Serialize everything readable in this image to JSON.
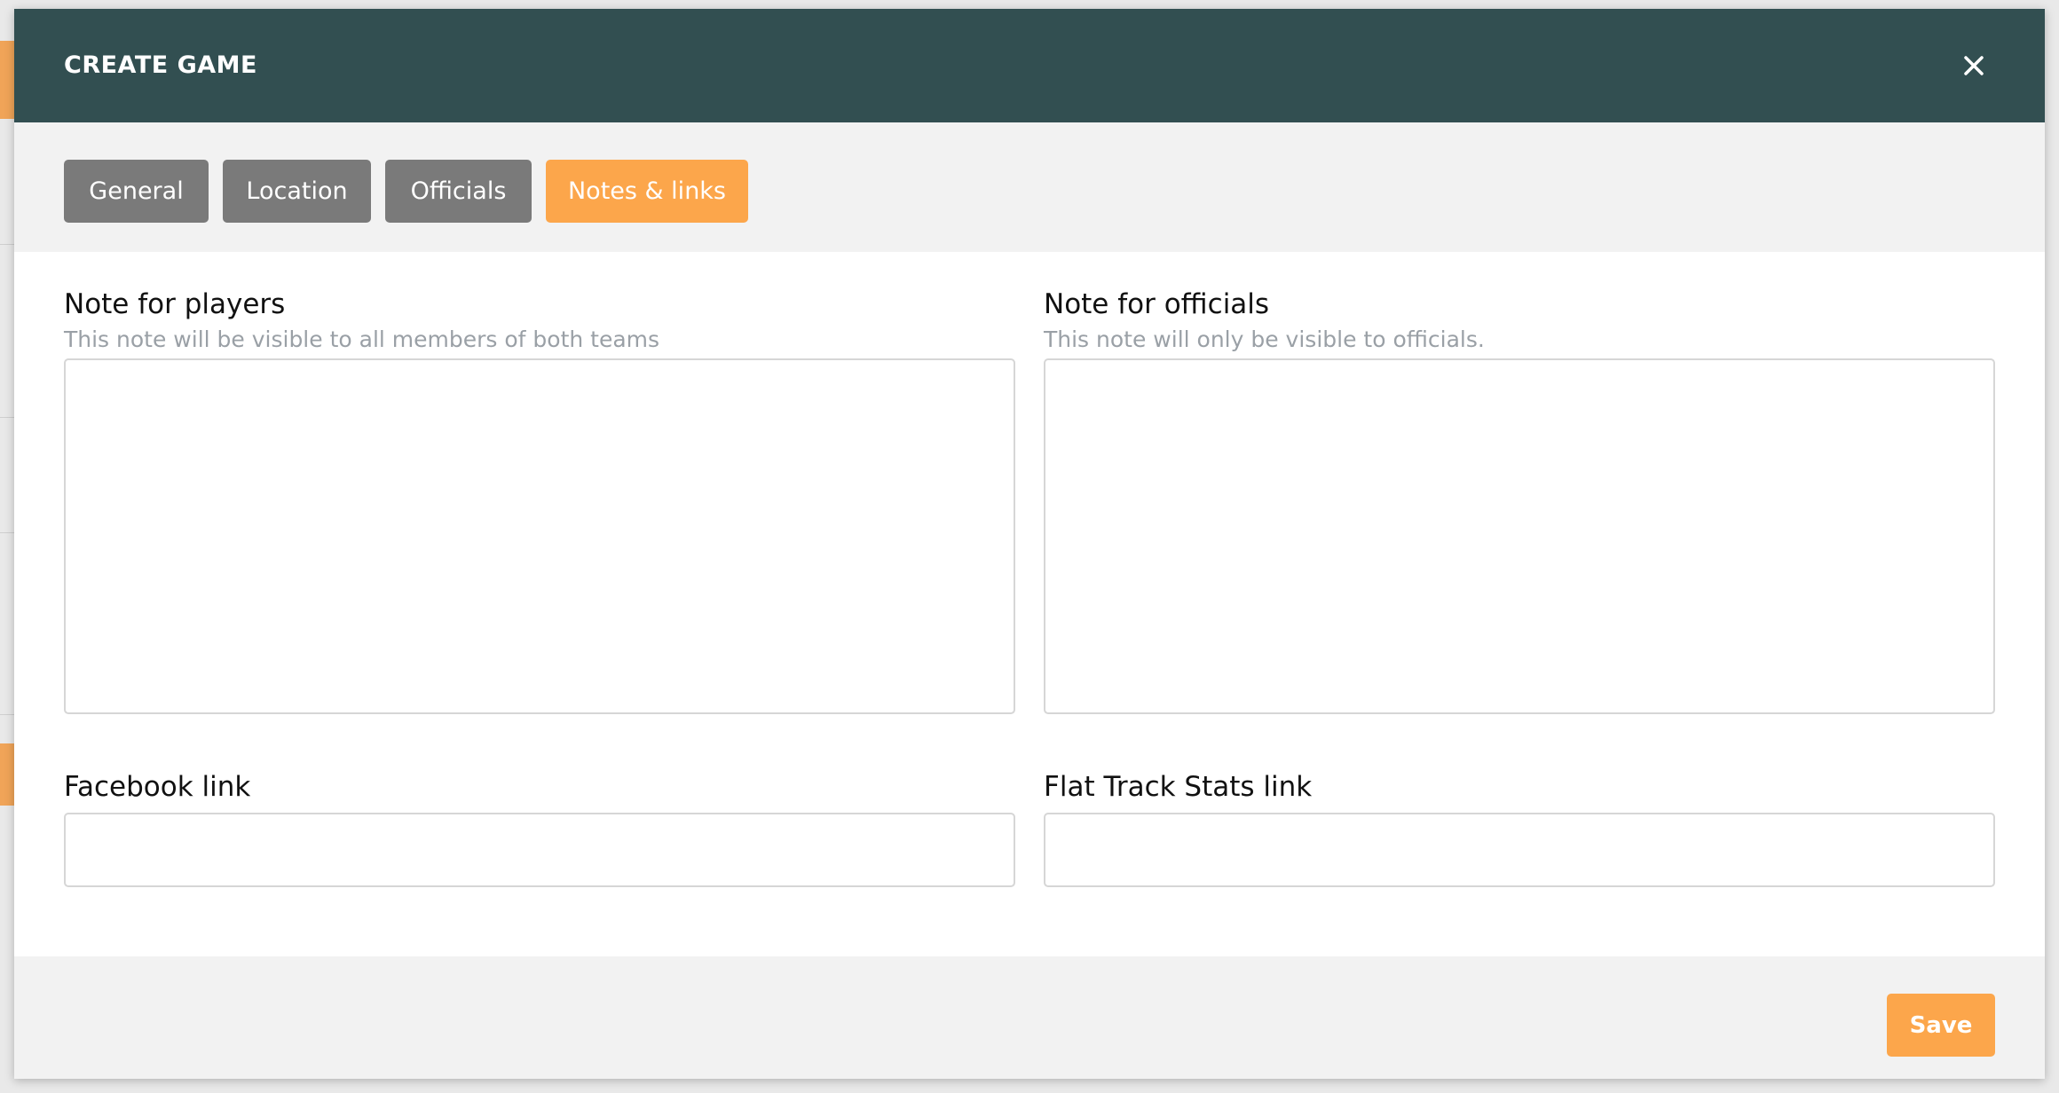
{
  "modal": {
    "title": "CREATE GAME",
    "close_icon": "close-icon"
  },
  "tabs": [
    {
      "label": "General",
      "active": false
    },
    {
      "label": "Location",
      "active": false
    },
    {
      "label": "Officials",
      "active": false
    },
    {
      "label": "Notes & links",
      "active": true
    }
  ],
  "notes": {
    "players": {
      "label": "Note for players",
      "hint": "This note will be visible to all members of both teams",
      "value": ""
    },
    "officials": {
      "label": "Note for officials",
      "hint": "This note will only be visible to officials.",
      "value": ""
    }
  },
  "links": {
    "facebook": {
      "label": "Facebook link",
      "value": ""
    },
    "flat_track_stats": {
      "label": "Flat Track Stats link",
      "value": ""
    }
  },
  "footer": {
    "save_label": "Save"
  },
  "colors": {
    "header": "#324f51",
    "accent": "#fca64b",
    "tab_inactive": "#7a7a7a",
    "panel": "#f2f2f2"
  }
}
